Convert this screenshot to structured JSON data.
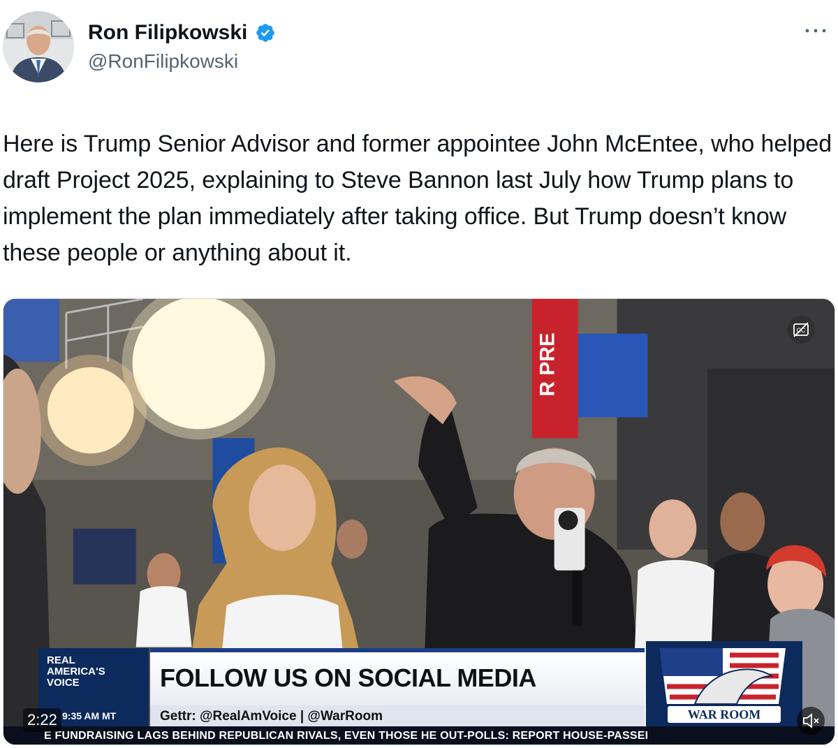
{
  "author": {
    "display_name": "Ron Filipkowski",
    "handle": "@RonFilipkowski",
    "verified": true,
    "avatar_icon": "avatar-photo"
  },
  "more_menu": {
    "icon": "more-horizontal-icon"
  },
  "tweet": {
    "text": "Here is Trump Senior Advisor and former appointee John McEntee, who helped draft Project 2025, explaining to Steve Bannon last July how Trump plans to implement the plan immediately after taking office. But Trump doesn’t know these people or anything about it."
  },
  "video": {
    "duration": "2:22",
    "cc_icon": "closed-captions-off-icon",
    "mute_icon": "muted-speaker-icon",
    "overlay": {
      "network_line1": "REAL",
      "network_line2": "AMERICA'S",
      "network_line3": "VOICE",
      "headline": "FOLLOW US ON SOCIAL MEDIA",
      "social": "Gettr: @RealAmVoice | @WarRoom",
      "clock": "9:35 AM MT",
      "show_logo": "WAR ROOM",
      "ticker": "E FUNDRAISING LAGS BEHIND REPUBLICAN RIVALS, EVEN THOSE HE OUT-POLLS: REPORT     HOUSE-PASSEI",
      "mic_flag": "REAL AMERICA'S VOICE"
    },
    "colors": {
      "navy": "#0d2a5c",
      "banner_red": "#c8232c",
      "ticker_bg": "#0a0f1e"
    }
  },
  "colors": {
    "text_primary": "#0f1419",
    "text_secondary": "#536471",
    "verified_blue": "#1d9bf0"
  }
}
